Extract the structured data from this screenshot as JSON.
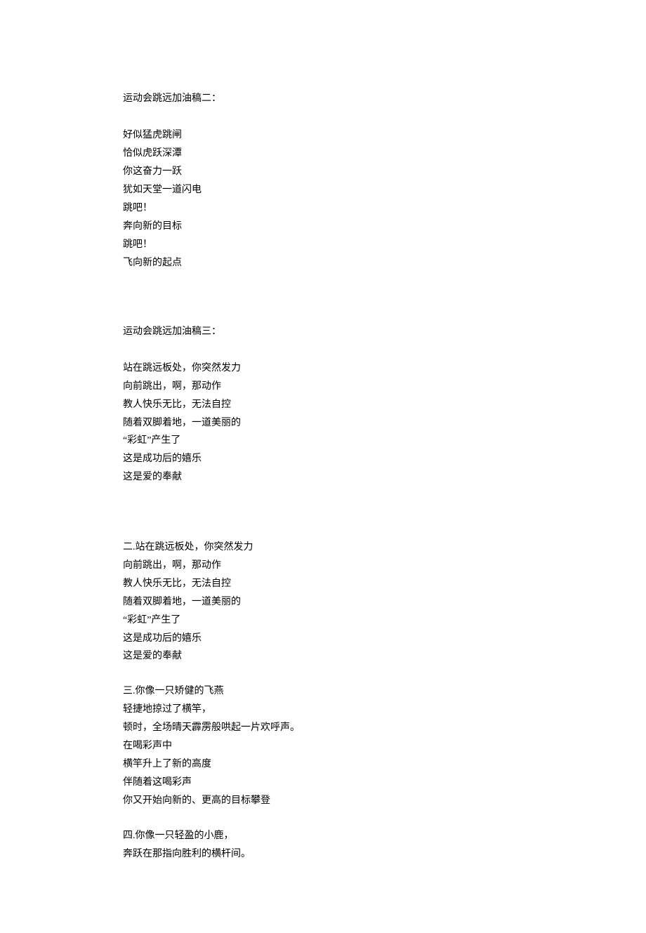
{
  "sections": [
    {
      "title": "运动会跳远加油稿二：",
      "lines": [
        "好似猛虎跳闸",
        "恰似虎跃深潭",
        "你这奋力一跃",
        "犹如天堂一道闪电",
        "跳吧！",
        "奔向新的目标",
        "跳吧！",
        "飞向新的起点"
      ]
    },
    {
      "title": "运动会跳远加油稿三：",
      "lines": [
        "站在跳远板处，你突然发力",
        "向前跳出，啊，那动作",
        "教人快乐无比，无法自控",
        "随着双脚着地，一道美丽的",
        "“彩虹”产生了",
        "这是成功后的嬉乐",
        "这是爱的奉献"
      ]
    }
  ],
  "blocks": [
    {
      "lines": [
        "二.站在跳远板处，你突然发力",
        "向前跳出，啊，那动作",
        "教人快乐无比，无法自控",
        "随着双脚着地，一道美丽的",
        "“彩虹”产生了",
        "这是成功后的嬉乐",
        "这是爱的奉献"
      ]
    },
    {
      "lines": [
        "三.你像一只矫健的飞燕",
        "轻捷地掠过了横竿，",
        "顿时，全场晴天霹雳般哄起一片欢呼声。",
        "在喝彩声中",
        "横竿升上了新的高度",
        "伴随着这喝彩声",
        "你又开始向新的、更高的目标攀登"
      ]
    },
    {
      "lines": [
        "四.你像一只轻盈的小鹿，",
        "奔跃在那指向胜利的横杆间。"
      ]
    }
  ]
}
